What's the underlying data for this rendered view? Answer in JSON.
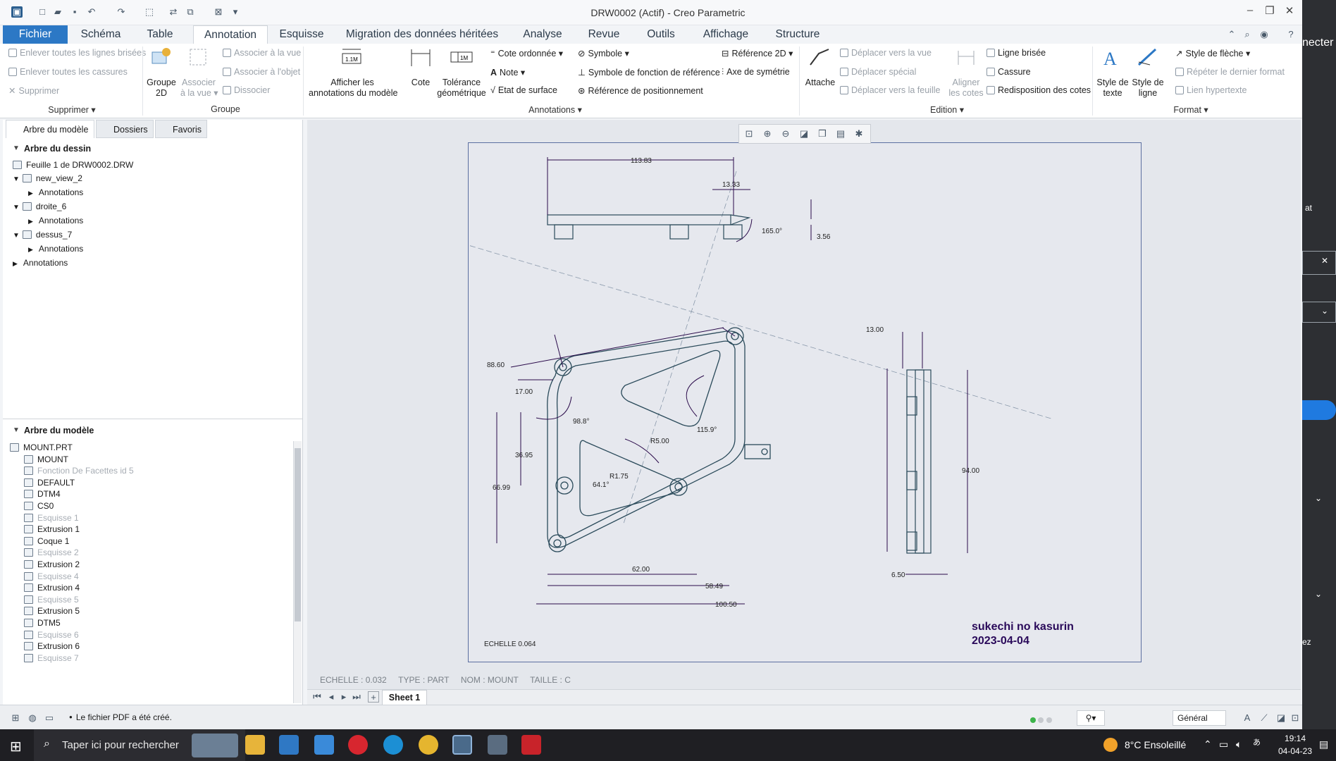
{
  "window": {
    "title": "DRW0002 (Actif) - Creo Parametric"
  },
  "tabs": [
    "Fichier",
    "Schéma",
    "Table",
    "Annotation",
    "Esquisse",
    "Migration des données héritées",
    "Analyse",
    "Revue",
    "Outils",
    "Affichage",
    "Structure"
  ],
  "ribbon": {
    "supprimer": {
      "enlever_lignes": "Enlever toutes les lignes brisées",
      "enlever_cassures": "Enlever toutes les cassures",
      "supprimer": "Supprimer",
      "label": "Supprimer"
    },
    "groupe": {
      "groupe2d_1": "Groupe",
      "groupe2d_2": "2D",
      "associer_vue_1": "Associer",
      "associer_vue_2": "à la vue",
      "associer_a_la_vue": "Associer à la vue",
      "associer_objet": "Associer à l'objet",
      "dissocier": "Dissocier",
      "label": "Groupe"
    },
    "annotations": {
      "afficher_1": "Afficher les",
      "afficher_2": "annotations du modèle",
      "cote": "Cote",
      "tolerance_1": "Tolérance",
      "tolerance_2": "géométrique",
      "cote_ordonnee": "Cote ordonnée",
      "note": "Note",
      "etat_surface": "Etat de surface",
      "symbole": "Symbole",
      "symbole_fonction": "Symbole de fonction de référence",
      "reference_positionnement": "Référence de positionnement",
      "reference_2d": "Référence 2D",
      "axe_symetrie": "Axe de symétrie",
      "label": "Annotations"
    },
    "edition": {
      "attache": "Attache",
      "deplacer_vue": "Déplacer vers la vue",
      "deplacer_special": "Déplacer spécial",
      "deplacer_feuille": "Déplacer vers la feuille",
      "aligner_1": "Aligner",
      "aligner_2": "les cotes",
      "ligne_brisee": "Ligne brisée",
      "cassure": "Cassure",
      "redisposition": "Redisposition des cotes",
      "label": "Edition"
    },
    "format": {
      "style_texte_1": "Style de",
      "style_texte_2": "texte",
      "style_ligne_1": "Style de",
      "style_ligne_2": "ligne",
      "style_fleche": "Style de flèche",
      "repeter": "Répéter le dernier format",
      "lien": "Lien hypertexte",
      "label": "Format"
    }
  },
  "panel": {
    "tabs": [
      "Arbre du modèle",
      "Dossiers",
      "Favoris"
    ],
    "drawing_tree_title": "Arbre du dessin",
    "drawing_tree": [
      {
        "label": "Feuille 1 de DRW0002.DRW"
      },
      {
        "label": "new_view_2"
      },
      {
        "label": "Annotations"
      },
      {
        "label": "droite_6"
      },
      {
        "label": "Annotations"
      },
      {
        "label": "dessus_7"
      },
      {
        "label": "Annotations"
      },
      {
        "label": "Annotations"
      }
    ],
    "model_tree_title": "Arbre du modèle",
    "model_tree": [
      {
        "label": "MOUNT.PRT",
        "dim": false
      },
      {
        "label": "MOUNT",
        "dim": false
      },
      {
        "label": "Fonction De Facettes id 5",
        "dim": true
      },
      {
        "label": "DEFAULT",
        "dim": false
      },
      {
        "label": "DTM4",
        "dim": false
      },
      {
        "label": "CS0",
        "dim": false
      },
      {
        "label": "Esquisse 1",
        "dim": true
      },
      {
        "label": "Extrusion 1",
        "dim": false
      },
      {
        "label": "Coque 1",
        "dim": false
      },
      {
        "label": "Esquisse 2",
        "dim": true
      },
      {
        "label": "Extrusion 2",
        "dim": false
      },
      {
        "label": "Esquisse 4",
        "dim": true
      },
      {
        "label": "Extrusion 4",
        "dim": false
      },
      {
        "label": "Esquisse 5",
        "dim": true
      },
      {
        "label": "Extrusion 5",
        "dim": false
      },
      {
        "label": "DTM5",
        "dim": false
      },
      {
        "label": "Esquisse 6",
        "dim": true
      },
      {
        "label": "Extrusion 6",
        "dim": false
      },
      {
        "label": "Esquisse 7",
        "dim": true
      }
    ]
  },
  "drawing": {
    "dims": {
      "d113": "113.83",
      "d13_33": "13.33",
      "a165": "165.0°",
      "d3_56": "3.56",
      "d88": "88.60",
      "d17": "17.00",
      "a98": "98.8°",
      "d36": "36.95",
      "d66": "66.99",
      "r5": "R5.00",
      "a115": "115.9°",
      "r175": "R1.75",
      "a64": "64.1°",
      "d62": "62.00",
      "d58": "58.49",
      "d100": "100.50",
      "d13": "13.00",
      "d94": "94.00",
      "d6_5": "6.50"
    },
    "scale_note": "ECHELLE 0.064",
    "author": "sukechi no kasurin",
    "date": "2023-04-04"
  },
  "info_line": "ECHELLE : 0.032     TYPE : PART     NOM : MOUNT     TAILLE : C",
  "sheet_tab": "Sheet 1",
  "status": {
    "message": "Le fichier PDF a été créé.",
    "filter": "Général"
  },
  "taskbar": {
    "search": "Taper ici pour rechercher",
    "weather": "8°C  Ensoleillé",
    "time": "19:14",
    "date": "04-04-23"
  },
  "right_strip": {
    "label": "necter",
    "label2": "ez",
    "label3": "at"
  },
  "colors": {
    "accent": "#2c78c5",
    "drawing_lines": "#2a4a5a",
    "dim_lines": "#2a0a4a",
    "author_text": "#2a0a5a"
  }
}
